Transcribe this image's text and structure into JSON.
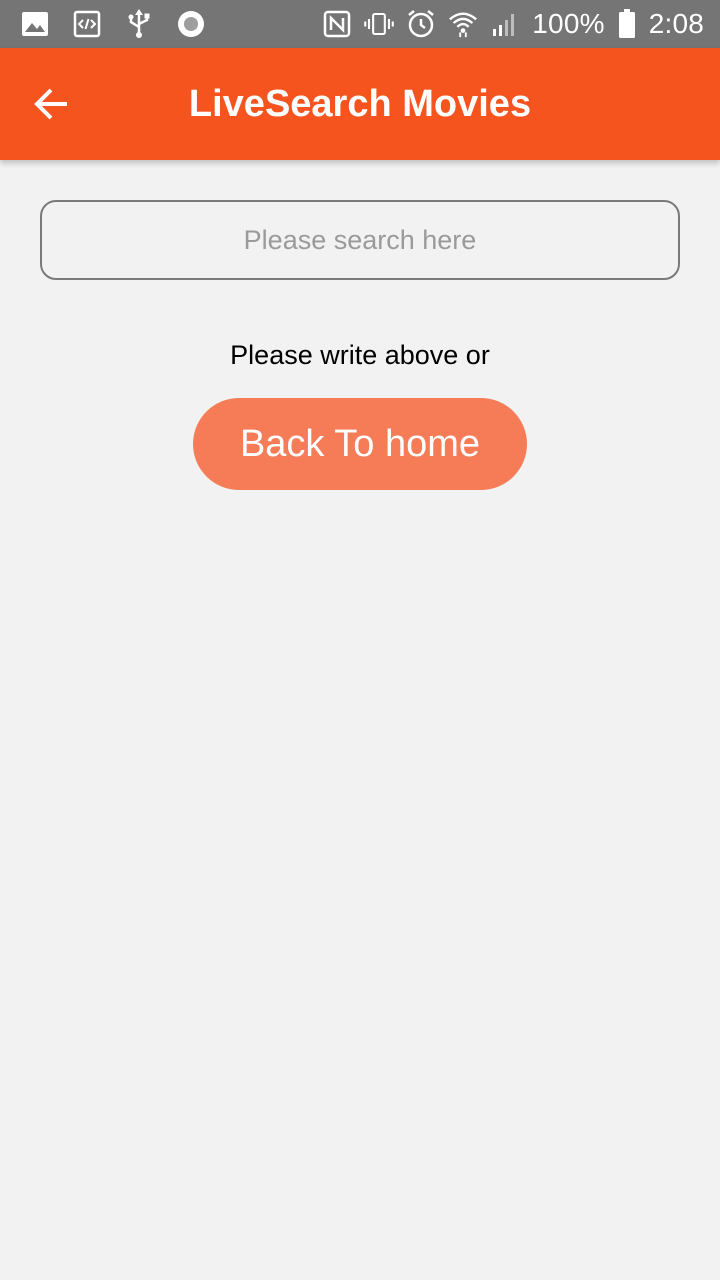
{
  "status_bar": {
    "left_icons": [
      "image-icon",
      "code-icon",
      "usb-icon",
      "record-icon"
    ],
    "right_icons": [
      "nfc-icon",
      "vibrate-icon",
      "alarm-icon",
      "wifi-icon",
      "signal-icon",
      "battery-icon"
    ],
    "battery_text": "100%",
    "time": "2:08"
  },
  "app_bar": {
    "title": "LiveSearch Movies",
    "background": "#f5541e",
    "back_icon": "arrow-back-icon"
  },
  "search": {
    "placeholder": "Please search here",
    "value": ""
  },
  "main": {
    "hint": "Please write above or",
    "home_button_label": "Back To home",
    "home_button_color": "#f67b57"
  }
}
